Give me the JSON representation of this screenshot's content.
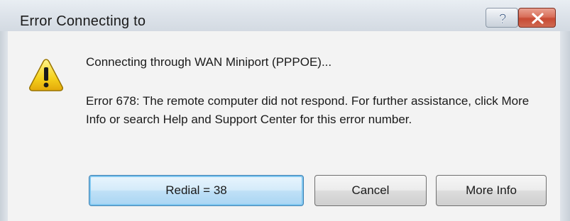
{
  "window": {
    "title": "Error Connecting to"
  },
  "titlebar": {
    "help_icon": "help-icon",
    "close_icon": "close-icon"
  },
  "content": {
    "icon": "warning-icon",
    "connecting_text": "Connecting through WAN Miniport (PPPOE)...",
    "error_text": "Error 678: The remote computer did not respond. For further assistance, click More Info or search Help and Support Center for this error number."
  },
  "buttons": {
    "redial_label": "Redial = 38",
    "cancel_label": "Cancel",
    "more_info_label": "More Info"
  },
  "colors": {
    "close_button": "#c84a33",
    "default_button_border": "#3c7fb1",
    "warning_fill": "#f5d11c"
  }
}
